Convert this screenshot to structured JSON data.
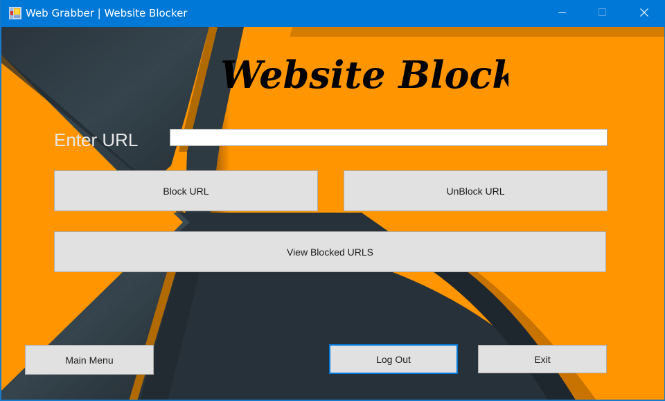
{
  "window": {
    "title": "Web Grabber | Website Blocker",
    "app_icon": "windows-form-icon",
    "controls": {
      "minimize": "minimize-icon",
      "maximize": "maximize-icon",
      "close": "close-icon"
    }
  },
  "heading": "Website Blocker",
  "form": {
    "url_label": "Enter URL",
    "url_value": "",
    "url_placeholder": ""
  },
  "buttons": {
    "block": "Block URL",
    "unblock": "UnBlock URL",
    "view_blocked": "View Blocked URLS",
    "main_menu": "Main Menu",
    "log_out": "Log Out",
    "exit": "Exit"
  },
  "colors": {
    "titlebar": "#0078d7",
    "accent_orange": "#ff9500",
    "dark_slate": "#28323a",
    "button_face": "#e1e1e1",
    "focus_border": "#0078d7"
  }
}
